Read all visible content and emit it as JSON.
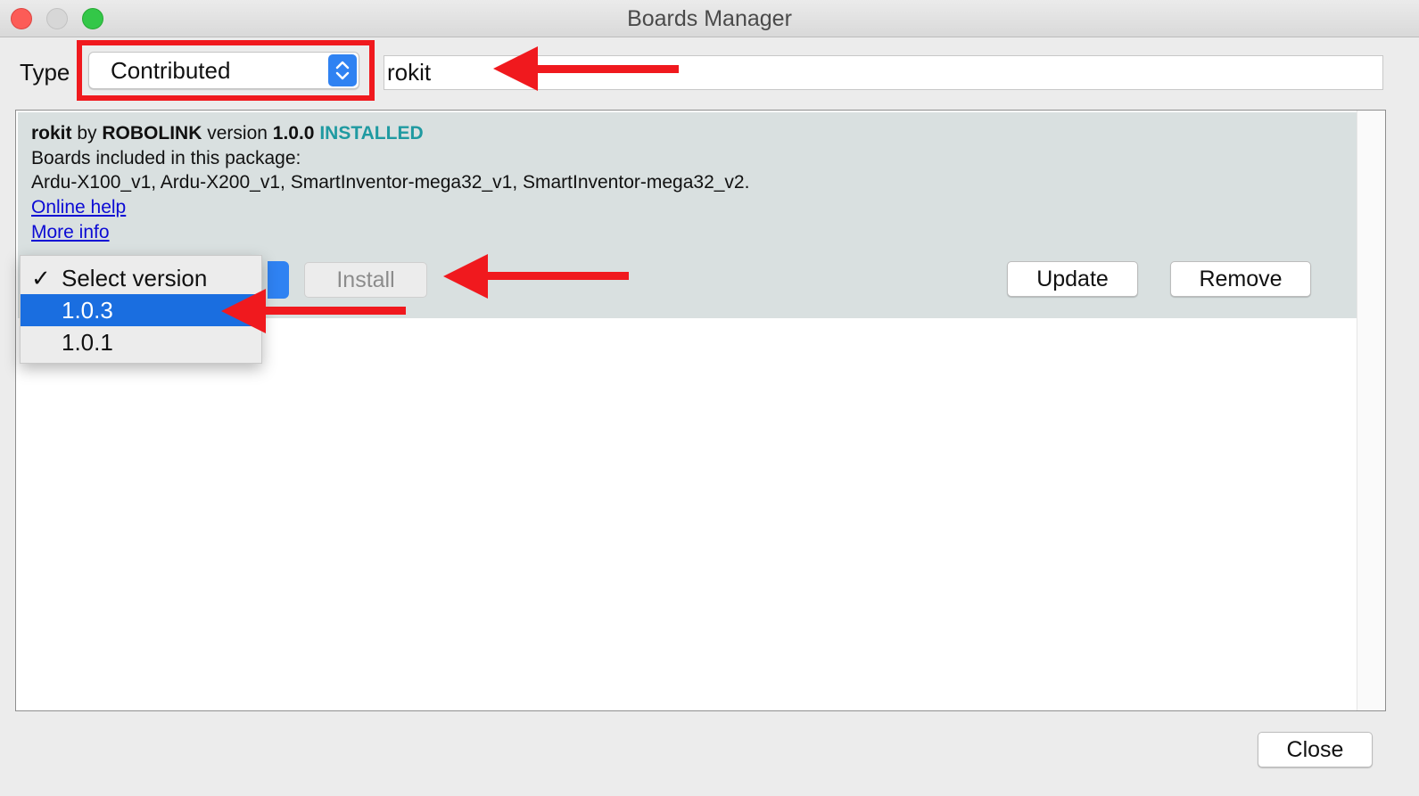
{
  "window": {
    "title": "Boards Manager"
  },
  "filter": {
    "type_label": "Type",
    "type_value": "Contributed",
    "search_value": "rokit"
  },
  "package": {
    "name": "rokit",
    "by_text": "by",
    "author": "ROBOLINK",
    "version_text": "version",
    "version": "1.0.0",
    "status": "INSTALLED",
    "boards_heading": "Boards included in this package:",
    "boards_list": "Ardu-X100_v1, Ardu-X200_v1, SmartInventor-mega32_v1, SmartInventor-mega32_v2.",
    "online_help": "Online help",
    "more_info": "More info"
  },
  "actions": {
    "install_label": "Install",
    "update_label": "Update",
    "remove_label": "Remove",
    "close_label": "Close"
  },
  "version_dropdown": {
    "check_mark": "✓",
    "items": [
      {
        "label": "Select version"
      },
      {
        "label": "1.0.3"
      },
      {
        "label": "1.0.1"
      }
    ]
  },
  "colors": {
    "highlight_red": "#f0191e",
    "selection_blue": "#1a6ee0",
    "installed_teal": "#1f9aa1",
    "link_blue": "#0c0bd4"
  },
  "icons": {
    "type_select": "chevron-up-down-icon",
    "window_controls": [
      "close-dot-icon",
      "minimize-dot-icon",
      "zoom-dot-icon"
    ]
  }
}
